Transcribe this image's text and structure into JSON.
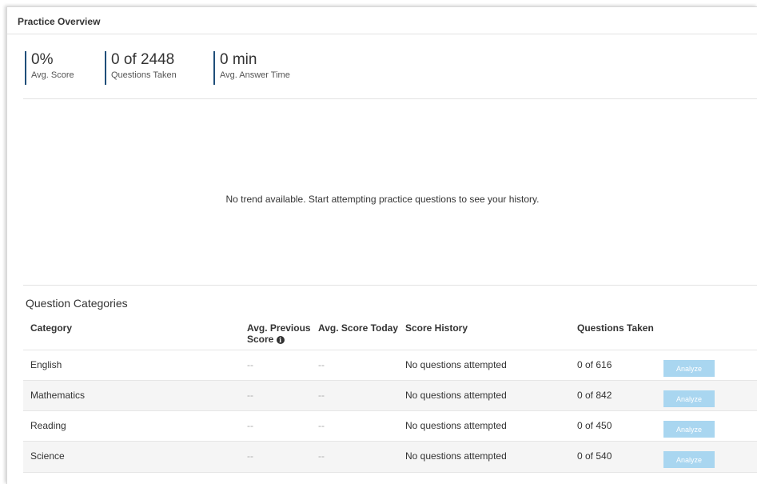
{
  "panel": {
    "title": "Practice Overview"
  },
  "stats": [
    {
      "value": "0%",
      "label": "Avg. Score"
    },
    {
      "value": "0 of 2448",
      "label": "Questions Taken"
    },
    {
      "value": "0 min",
      "label": "Avg. Answer Time"
    }
  ],
  "trend": {
    "message": "No trend available. Start attempting practice questions to see your history."
  },
  "categories": {
    "title": "Question Categories",
    "headers": {
      "category": "Category",
      "avg_previous_line1": "Avg. Previous",
      "avg_previous_line2": "Score",
      "avg_today": "Avg. Score Today",
      "score_history": "Score History",
      "questions_taken": "Questions Taken"
    },
    "rows": [
      {
        "category": "English",
        "avg_previous": "--",
        "avg_today": "--",
        "score_history": "No questions attempted",
        "questions_taken": "0 of 616",
        "action": "Analyze"
      },
      {
        "category": "Mathematics",
        "avg_previous": "--",
        "avg_today": "--",
        "score_history": "No questions attempted",
        "questions_taken": "0 of 842",
        "action": "Analyze"
      },
      {
        "category": "Reading",
        "avg_previous": "--",
        "avg_today": "--",
        "score_history": "No questions attempted",
        "questions_taken": "0 of 450",
        "action": "Analyze"
      },
      {
        "category": "Science",
        "avg_previous": "--",
        "avg_today": "--",
        "score_history": "No questions attempted",
        "questions_taken": "0 of 540",
        "action": "Analyze"
      }
    ]
  },
  "colors": {
    "stat_accent": "#1f4e79",
    "analyze_button": "#a9d6f0",
    "row_alt": "#f5f5f5"
  },
  "icons": {
    "info": "info-circle-icon"
  }
}
